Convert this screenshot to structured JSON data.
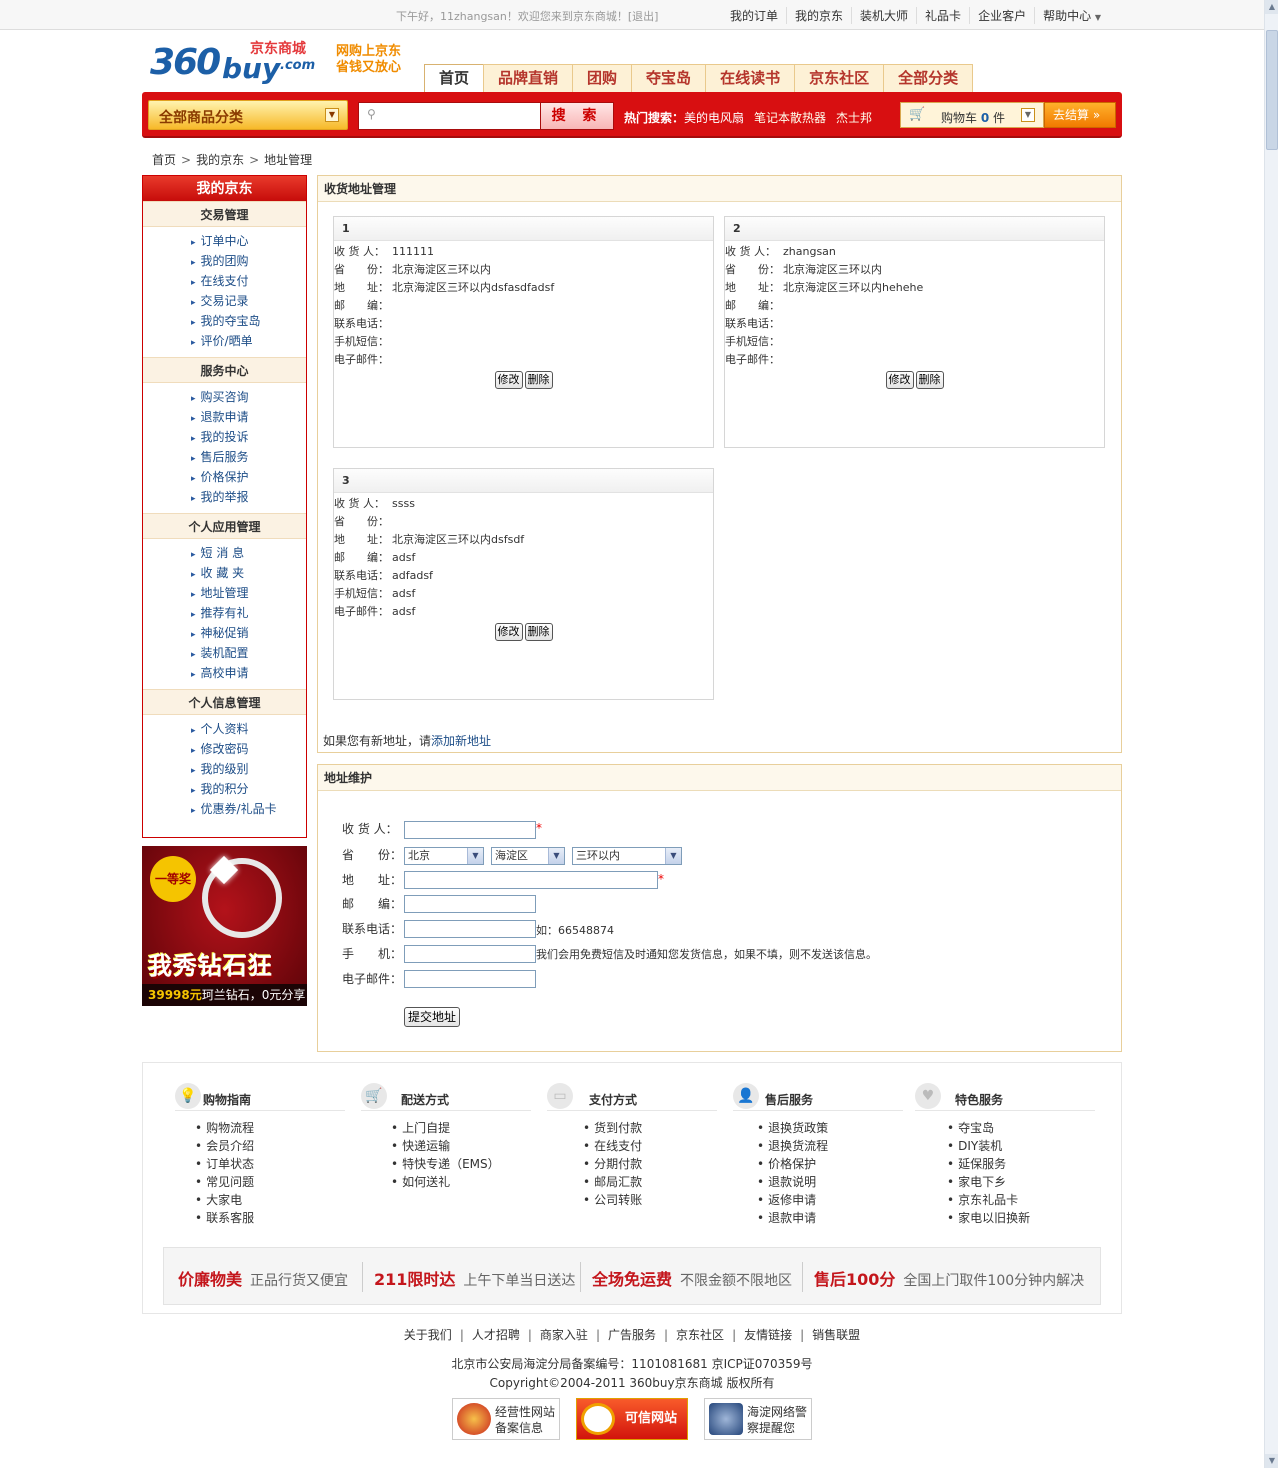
{
  "topbar": {
    "greeting": "下午好，11zhangsan！欢迎您来到京东商城！[退出]",
    "links": [
      "我的订单",
      "我的京东",
      "装机大师",
      "礼品卡",
      "企业客户",
      "帮助中心"
    ]
  },
  "logo": {
    "n360": "360",
    "buy": "buy",
    "com": ".com",
    "jd": "京东商城"
  },
  "slogan": [
    "网购上京东",
    "省钱又放心"
  ],
  "nav": [
    "首页",
    "品牌直销",
    "团购",
    "夺宝岛",
    "在线读书",
    "京东社区",
    "全部分类"
  ],
  "search": {
    "category_label": "全部商品分类",
    "button": "搜 索",
    "hot_label": "热门搜索：",
    "hot": [
      "美的电风扇",
      "笔记本散热器",
      "杰士邦"
    ]
  },
  "cart": {
    "label": "购物车",
    "count": "0",
    "unit": "件",
    "checkout": "去结算"
  },
  "breadcrumb": [
    "首页",
    "我的京东",
    "地址管理"
  ],
  "sidebar": {
    "title": "我的京东",
    "sections": [
      {
        "title": "交易管理",
        "items": [
          "订单中心",
          "我的团购",
          "在线支付",
          "交易记录",
          "我的夺宝岛",
          "评价/晒单"
        ]
      },
      {
        "title": "服务中心",
        "items": [
          "购买咨询",
          "退款申请",
          "我的投诉",
          "售后服务",
          "价格保护",
          "我的举报"
        ]
      },
      {
        "title": "个人应用管理",
        "items": [
          "短 消 息",
          "收 藏 夹",
          "地址管理",
          "推荐有礼",
          "神秘促销",
          "装机配置",
          "高校申请"
        ]
      },
      {
        "title": "个人信息管理",
        "items": [
          "个人资料",
          "修改密码",
          "我的级别",
          "我的积分",
          "优惠券/礼品卡"
        ]
      }
    ]
  },
  "banner": {
    "badge": "一等奖",
    "headline": "我秀钻石狂",
    "price": "39998元",
    "caption": "珂兰钻石，0元分享"
  },
  "address_panel": {
    "title": "收货地址管理",
    "labels": {
      "receiver": "收 货 人：",
      "province": "省　　份：",
      "address": "地　　址：",
      "zip": "邮　　编：",
      "phone": "联系电话：",
      "sms": "手机短信：",
      "email": "电子邮件："
    },
    "cards": [
      {
        "no": "1",
        "receiver": "111111",
        "province": "北京海淀区三环以内",
        "address": "北京海淀区三环以内dsfasdfadsf",
        "zip": "",
        "phone": "",
        "sms": "",
        "email": ""
      },
      {
        "no": "2",
        "receiver": "zhangsan",
        "province": "北京海淀区三环以内",
        "address": "北京海淀区三环以内hehehe",
        "zip": "",
        "phone": "",
        "sms": "",
        "email": ""
      },
      {
        "no": "3",
        "receiver": "ssss",
        "province": "",
        "address": "北京海淀区三环以内dsfsdf",
        "zip": "adsf",
        "phone": "adfadsf",
        "sms": "adsf",
        "email": "adsf"
      }
    ],
    "edit_label": "修改",
    "delete_label": "删除",
    "add_prefix": "如果您有新地址，请",
    "add_link": "添加新地址"
  },
  "form_panel": {
    "title": "地址维护",
    "labels": {
      "receiver": "收 货 人：",
      "province": "省　　份：",
      "address": "地　　址：",
      "zip": "邮　　编：",
      "phone": "联系电话：",
      "mobile": "手　　机：",
      "email": "电子邮件："
    },
    "values": {
      "receiver": "",
      "address": "",
      "zip": "",
      "phone": "",
      "mobile": "",
      "email": ""
    },
    "selects": {
      "province": "北京",
      "district": "海淀区",
      "area": "三环以内"
    },
    "phone_hint": "如：66548874",
    "mobile_hint": "我们会用免费短信及时通知您发货信息，如果不填，则不发送该信息。",
    "required_mark": "*",
    "submit": "提交地址"
  },
  "help": [
    {
      "icon": "lightbulb-icon",
      "title": "购物指南",
      "items": [
        "购物流程",
        "会员介绍",
        "订单状态",
        "常见问题",
        "大家电",
        "联系客服"
      ]
    },
    {
      "icon": "cart-icon",
      "title": "配送方式",
      "items": [
        "上门自提",
        "快递运输",
        "特快专递（EMS）",
        "如何送礼"
      ]
    },
    {
      "icon": "card-icon",
      "title": "支付方式",
      "items": [
        "货到付款",
        "在线支付",
        "分期付款",
        "邮局汇款",
        "公司转账"
      ]
    },
    {
      "icon": "person-icon",
      "title": "售后服务",
      "items": [
        "退换货政策",
        "退换货流程",
        "价格保护",
        "退款说明",
        "返修申请",
        "退款申请"
      ]
    },
    {
      "icon": "heart-icon",
      "title": "特色服务",
      "items": [
        "夺宝岛",
        "DIY装机",
        "延保服务",
        "家电下乡",
        "京东礼品卡",
        "家电以旧换新"
      ]
    }
  ],
  "promo": [
    {
      "bold": "价廉物美",
      "small": "正品行货又便宜"
    },
    {
      "bold": "211限时达",
      "small": "上午下单当日送达"
    },
    {
      "bold": "全场免运费",
      "small": "不限金额不限地区"
    },
    {
      "bold": "售后100分",
      "small": "全国上门取件100分钟内解决"
    }
  ],
  "bottom_links": [
    "关于我们",
    "人才招聘",
    "商家入驻",
    "广告服务",
    "京东社区",
    "友情链接",
    "销售联盟"
  ],
  "icp": "北京市公安局海淀分局备案编号：1101081681 京ICP证070359号",
  "copyright": "Copyright©2004-2011  360buy京东商城 版权所有",
  "badges": [
    {
      "line1": "经营性网站",
      "line2": "备案信息"
    },
    {
      "line1": "可信网站",
      "line2": ""
    },
    {
      "line1": "海淀网络警",
      "line2": "察提醒您"
    }
  ],
  "colors": {
    "brand_red": "#d80f11",
    "link_blue": "#1d4d87",
    "accent_orange": "#f17a00"
  }
}
